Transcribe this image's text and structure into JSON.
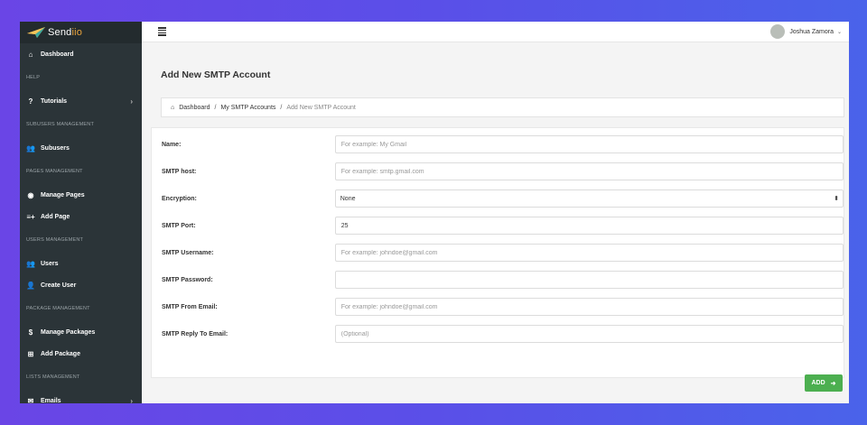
{
  "brand": {
    "name_prefix": "Send",
    "name_suffix": "iio"
  },
  "sidebar": {
    "items": [
      {
        "type": "item",
        "label": "Dashboard",
        "icon": "home-icon",
        "glyph": "⌂"
      },
      {
        "type": "header",
        "label": "HELP"
      },
      {
        "type": "item",
        "label": "Tutorials",
        "icon": "question-circle-icon",
        "glyph": "?",
        "chevron": "›"
      },
      {
        "type": "header",
        "label": "SUBUSERS MANAGEMENT"
      },
      {
        "type": "item",
        "label": "Subusers",
        "icon": "users-icon",
        "glyph": "👥"
      },
      {
        "type": "header",
        "label": "PAGES MANAGEMENT"
      },
      {
        "type": "item",
        "label": "Manage Pages",
        "icon": "globe-icon",
        "glyph": "◉"
      },
      {
        "type": "item",
        "label": "Add Page",
        "icon": "list-add-icon",
        "glyph": "≡+"
      },
      {
        "type": "header",
        "label": "USERS MANAGEMENT"
      },
      {
        "type": "item",
        "label": "Users",
        "icon": "users-icon",
        "glyph": "👥"
      },
      {
        "type": "item",
        "label": "Create User",
        "icon": "user-add-icon",
        "glyph": "👤"
      },
      {
        "type": "header",
        "label": "PACKAGE MANAGEMENT"
      },
      {
        "type": "item",
        "label": "Manage Packages",
        "icon": "dollar-circle-icon",
        "glyph": "$"
      },
      {
        "type": "item",
        "label": "Add Package",
        "icon": "plus-square-icon",
        "glyph": "⊞"
      },
      {
        "type": "header",
        "label": "LISTS MANAGEMENT"
      },
      {
        "type": "item",
        "label": "Emails",
        "icon": "envelope-icon",
        "glyph": "✉",
        "chevron": "›"
      }
    ]
  },
  "topbar": {
    "user_name": "Joshua Zamora"
  },
  "page": {
    "title": "Add New SMTP Account"
  },
  "breadcrumb": {
    "home": "Dashboard",
    "parent": "My SMTP Accounts",
    "current": "Add New SMTP Account"
  },
  "form": {
    "name": {
      "label": "Name:",
      "placeholder": "For example: My Gmail",
      "value": ""
    },
    "host": {
      "label": "SMTP host:",
      "placeholder": "For example: smtp.gmail.com",
      "value": ""
    },
    "encryption": {
      "label": "Encryption:",
      "selected": "None"
    },
    "port": {
      "label": "SMTP Port:",
      "placeholder": "",
      "value": "25"
    },
    "username": {
      "label": "SMTP Username:",
      "placeholder": "For example: johndoe@gmail.com",
      "value": ""
    },
    "password": {
      "label": "SMTP Password:",
      "placeholder": "",
      "value": ""
    },
    "from_email": {
      "label": "SMTP From Email:",
      "placeholder": "For example: johndoe@gmail.com",
      "value": ""
    },
    "reply_to": {
      "label": "SMTP Reply To Email:",
      "placeholder": "(Optional)",
      "value": ""
    },
    "submit_label": "ADD"
  },
  "colors": {
    "sidebar_bg": "#2b3438",
    "accent": "#4caf50",
    "brand_accent": "#e8a33c"
  }
}
